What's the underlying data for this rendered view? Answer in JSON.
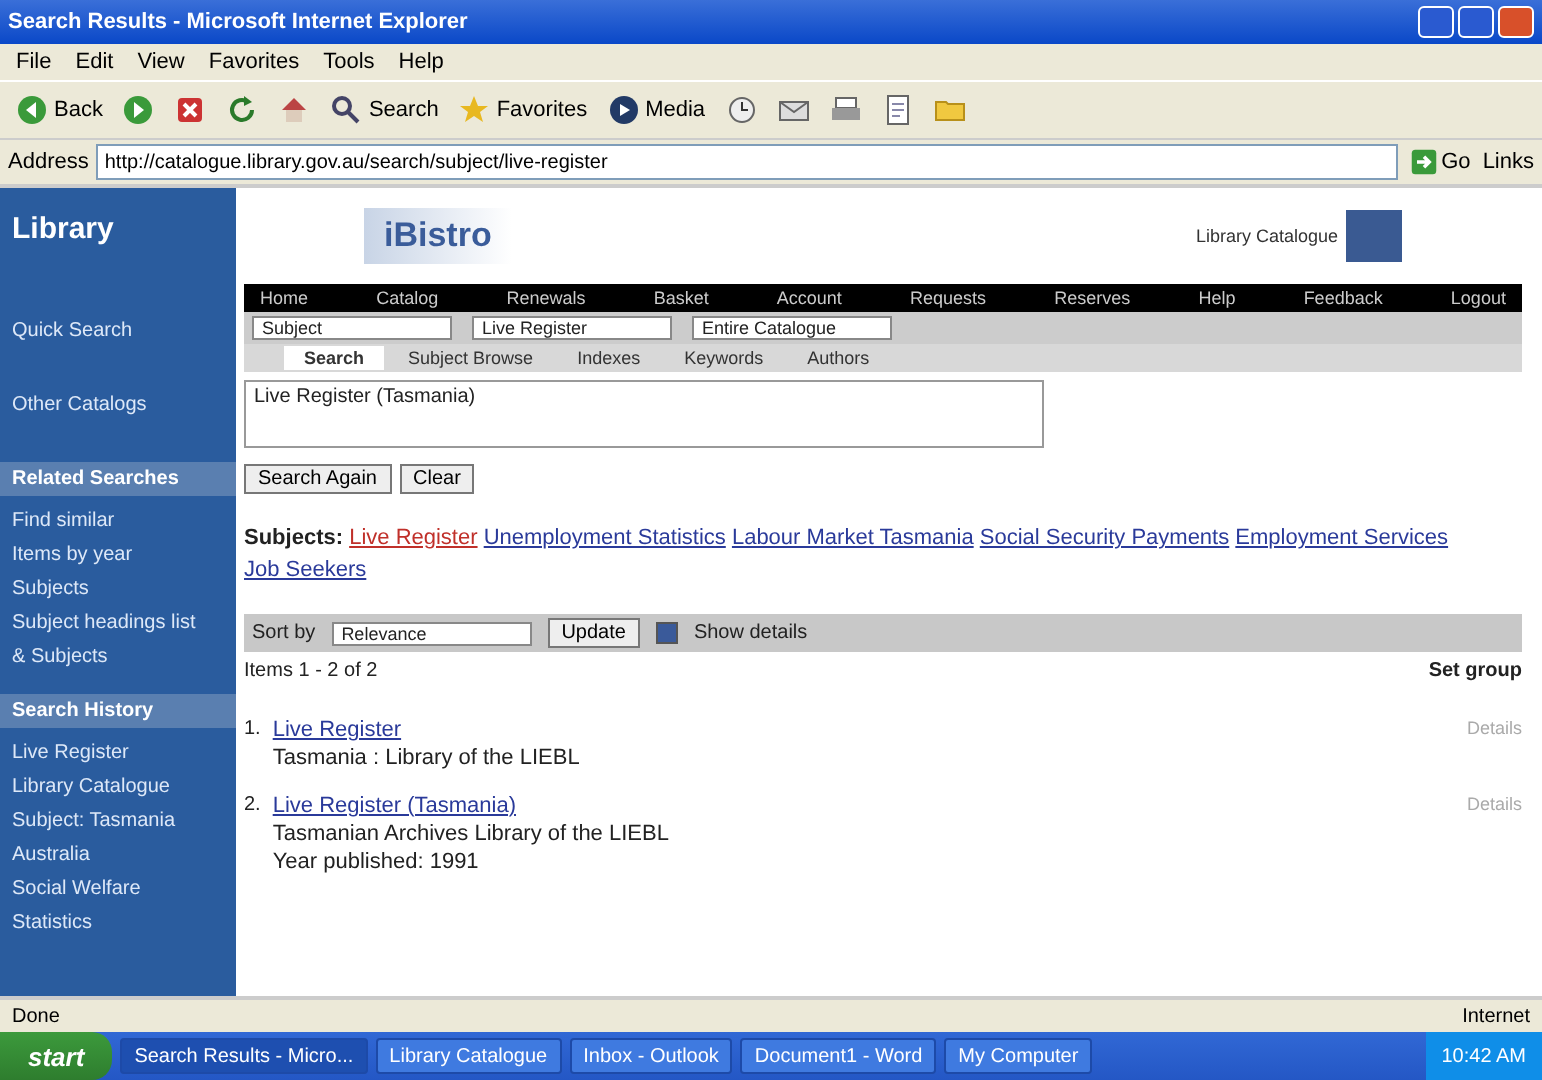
{
  "window": {
    "title": "Search Results - Microsoft Internet Explorer"
  },
  "menu": [
    "File",
    "Edit",
    "View",
    "Favorites",
    "Tools",
    "Help"
  ],
  "toolbar": [
    {
      "kind": "back",
      "label": "Back"
    },
    {
      "kind": "forward"
    },
    {
      "kind": "stop"
    },
    {
      "kind": "refresh"
    },
    {
      "kind": "home"
    },
    {
      "kind": "search",
      "label": "Search"
    },
    {
      "kind": "favorites",
      "label": "Favorites"
    },
    {
      "kind": "media",
      "label": "Media"
    },
    {
      "kind": "history"
    },
    {
      "kind": "mail"
    },
    {
      "kind": "print"
    },
    {
      "kind": "edit"
    },
    {
      "kind": "folder"
    }
  ],
  "address": {
    "label": "Address",
    "value": "http://catalogue.library.gov.au/search/subject/live-register",
    "go": "Go",
    "links": "Links"
  },
  "sidebar": {
    "logo": "Library",
    "groups": [
      {
        "links": [
          "Quick Search",
          "Other Catalogs"
        ]
      },
      {
        "heading": "Related Searches",
        "links": [
          "Find similar",
          "Items by year",
          "Subjects",
          "Subject headings list",
          "& Subjects"
        ]
      },
      {
        "heading": "Search History",
        "links": [
          "Live Register",
          "Library Catalogue",
          "Subject: Tasmania",
          "Australia",
          "Social Welfare",
          "Statistics"
        ]
      }
    ]
  },
  "header": {
    "brand": "iBistro",
    "seal": "Library Catalogue"
  },
  "nav": [
    "Home",
    "Catalog",
    "Renewals",
    "Basket",
    "Account",
    "Requests",
    "Reserves",
    "Help",
    "Feedback",
    "Logout"
  ],
  "search": {
    "index": "Subject",
    "value": "Live Register",
    "scope": "Entire Catalogue"
  },
  "tabs": [
    {
      "label": "Search",
      "selected": true
    },
    {
      "label": "Subject Browse",
      "selected": false
    },
    {
      "label": "Indexes",
      "selected": false
    },
    {
      "label": "Keywords",
      "selected": false
    },
    {
      "label": "Authors",
      "selected": false
    }
  ],
  "query": "Live Register (Tasmania)",
  "buttons": [
    "Search Again",
    "Clear"
  ],
  "subjects": {
    "label": "Subjects:",
    "terms": [
      {
        "text": "Live Register",
        "selected": true
      },
      {
        "text": "Unemployment Statistics",
        "selected": false
      },
      {
        "text": "Labour Market Tasmania",
        "selected": false
      },
      {
        "text": "Social Security Payments",
        "selected": false
      },
      {
        "text": "Employment Services",
        "selected": false
      },
      {
        "text": "Job Seekers",
        "selected": false
      }
    ]
  },
  "sortbar": {
    "label": "Sort by",
    "select": "Relevance",
    "button": "Update",
    "checked": true,
    "option": "Show details"
  },
  "count": "Items 1 - 2 of 2",
  "group": "Set group",
  "results": [
    {
      "number": "1.",
      "title": "Live Register",
      "lines": [
        "Tasmania : Library of the LIEBL"
      ],
      "side": "Details"
    },
    {
      "number": "2.",
      "title": "Live Register (Tasmania)",
      "lines": [
        "Tasmanian Archives Library of the LIEBL",
        "Year published: 1991"
      ],
      "side": "Details"
    }
  ],
  "status": {
    "text": "Done",
    "zone": "Internet"
  },
  "taskbar": {
    "start": "start",
    "tasks": [
      "Search Results - Micro...",
      "Library Catalogue",
      "Inbox - Outlook",
      "Document1 - Word",
      "My Computer"
    ],
    "clock": "10:42 AM"
  }
}
